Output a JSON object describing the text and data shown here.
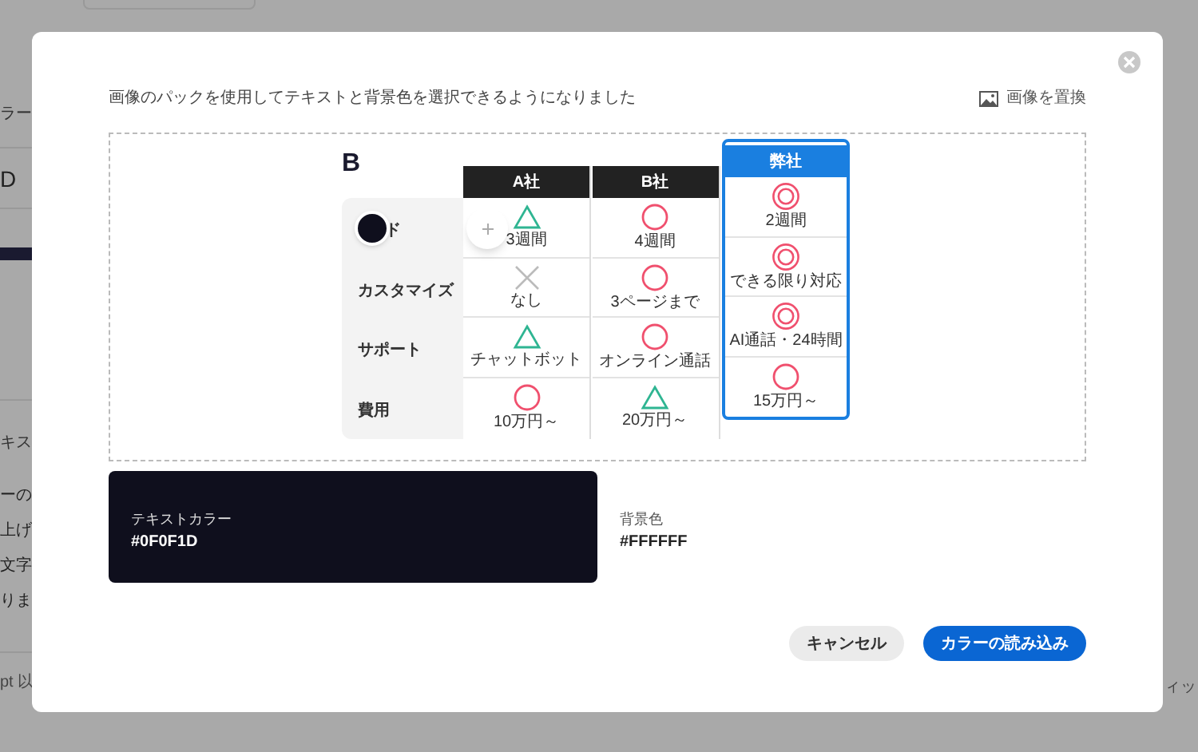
{
  "background": {
    "texts": [
      {
        "text": "ラー",
        "kind": "label"
      },
      {
        "text": "D",
        "kind": "value"
      },
      {
        "text": "キス",
        "kind": "label"
      },
      {
        "text": "ーの",
        "kind": "body"
      },
      {
        "text": "上げ",
        "kind": "body"
      },
      {
        "text": "文字",
        "kind": "body"
      },
      {
        "text": "りま",
        "kind": "body"
      },
      {
        "text": "pt 以",
        "kind": "note"
      }
    ],
    "right_text": "ィッ"
  },
  "dialog": {
    "description": "画像のパックを使用してテキストと背景色を選択できるようになりました",
    "replace_image": "画像を置換",
    "image": {
      "heading": "B",
      "columns": [
        {
          "label": "A社",
          "selected": false
        },
        {
          "label": "B社",
          "selected": false
        },
        {
          "label": "弊社",
          "selected": true
        }
      ],
      "rows": [
        {
          "label": "ド",
          "cells": [
            {
              "kind": "triangle",
              "text": "3週間"
            },
            {
              "kind": "circle",
              "text": "4週間"
            },
            {
              "kind": "double",
              "text": "2週間"
            }
          ]
        },
        {
          "label": "カスタマイズ",
          "cells": [
            {
              "kind": "cross",
              "text": "なし"
            },
            {
              "kind": "circle",
              "text": "3ページまで"
            },
            {
              "kind": "double",
              "text": "できる限り対応"
            }
          ]
        },
        {
          "label": "サポート",
          "cells": [
            {
              "kind": "triangle",
              "text": "チャットボット"
            },
            {
              "kind": "circle",
              "text": "オンライン通話"
            },
            {
              "kind": "double",
              "text": "AI通話・24時間"
            }
          ]
        },
        {
          "label": "費用",
          "cells": [
            {
              "kind": "circle",
              "text": "10万円～"
            },
            {
              "kind": "triangle",
              "text": "20万円～"
            },
            {
              "kind": "circle",
              "text": "15万円～"
            }
          ]
        }
      ]
    },
    "swatches": [
      {
        "label": "テキストカラー",
        "value": "#0F0F1D",
        "color": "#0f0f1d"
      },
      {
        "label": "背景色",
        "value": "#FFFFFF",
        "color": "#ffffff"
      }
    ],
    "buttons": [
      {
        "label": "キャンセル",
        "kind": "secondary"
      },
      {
        "label": "カラーの読み込み",
        "kind": "primary"
      }
    ]
  }
}
